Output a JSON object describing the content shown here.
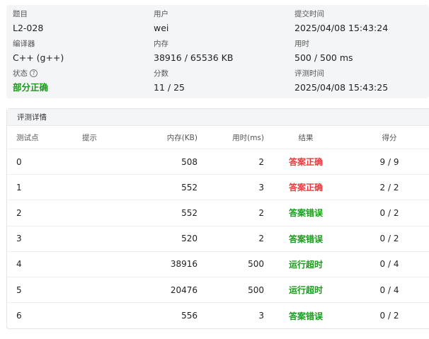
{
  "summary": {
    "problem_label": "题目",
    "problem_value": "L2-028",
    "user_label": "用户",
    "user_value": "wei",
    "submit_time_label": "提交时间",
    "submit_time_value": "2025/04/08 15:43:24",
    "compiler_label": "编译器",
    "compiler_value": "C++ (g++)",
    "memory_label": "内存",
    "memory_value": "38916 / 65536 KB",
    "time_label": "用时",
    "time_value": "500 / 500 ms",
    "status_label": "状态",
    "status_help_glyph": "?",
    "status_value": "部分正确",
    "score_label": "分数",
    "score_value": "11 / 25",
    "judge_time_label": "评测时间",
    "judge_time_value": "2025/04/08 15:43:25",
    "status_color": "#1a9a1a"
  },
  "details": {
    "title": "评测详情",
    "headers": [
      "测试点",
      "提示",
      "内存(KB)",
      "用时(ms)",
      "结果",
      "得分"
    ],
    "rows": [
      {
        "case": "0",
        "hint": "",
        "memory": "508",
        "time": "2",
        "result": "答案正确",
        "score": "9 / 9"
      },
      {
        "case": "1",
        "hint": "",
        "memory": "552",
        "time": "3",
        "result": "答案正确",
        "score": "2 / 2"
      },
      {
        "case": "2",
        "hint": "",
        "memory": "552",
        "time": "2",
        "result": "答案错误",
        "score": "0 / 2"
      },
      {
        "case": "3",
        "hint": "",
        "memory": "520",
        "time": "2",
        "result": "答案错误",
        "score": "0 / 2"
      },
      {
        "case": "4",
        "hint": "",
        "memory": "38916",
        "time": "500",
        "result": "运行超时",
        "score": "0 / 4"
      },
      {
        "case": "5",
        "hint": "",
        "memory": "20476",
        "time": "500",
        "result": "运行超时",
        "score": "0 / 4"
      },
      {
        "case": "6",
        "hint": "",
        "memory": "556",
        "time": "3",
        "result": "答案错误",
        "score": "0 / 2"
      }
    ],
    "result_colors": {
      "答案正确": "#e23b3b",
      "答案错误": "#1a9a1a",
      "运行超时": "#1a9a1a"
    }
  }
}
